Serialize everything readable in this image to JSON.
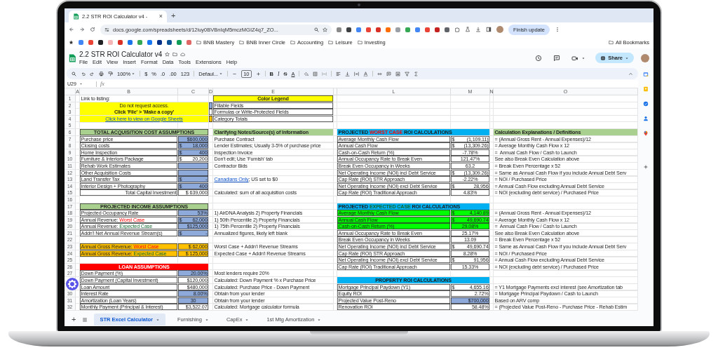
{
  "browser": {
    "tab_title": "2.2 STR ROI Calculator v4 -",
    "tab_close": "×",
    "new_tab": "+",
    "url": "docs.google.com/spreadsheets/d/12iuy0BVBnIqM5mczMGIZ4q7_ZO...",
    "update_button": "Finish update",
    "bookmark_folders": [
      "BNB Mastery",
      "BNB Inner Circle",
      "Accounting",
      "Leisure",
      "Investing"
    ],
    "all_bookmarks": "All Bookmarks"
  },
  "doc": {
    "title": "2.2 STR ROI Calculator v4",
    "menu": [
      "File",
      "Edit",
      "View",
      "Insert",
      "Format",
      "Data",
      "Tools",
      "Extensions",
      "Help"
    ],
    "share": "Share"
  },
  "toolbar": {
    "zoom": "100%",
    "currency": "$",
    "percent": "%",
    "decimal_less": ".0",
    "decimal_more": ".00",
    "number_format": "123",
    "font": "Defaul...",
    "font_size": "10",
    "bold": "B",
    "italic": "I",
    "strikethrough": "S",
    "text_color": "A"
  },
  "formula_bar": {
    "name_box": "U29",
    "label": "fx"
  },
  "columns": [
    "A",
    "B",
    "C",
    "D",
    "E",
    "L",
    "M",
    "N",
    "O"
  ],
  "rows": [
    {
      "number": "1",
      "B": {
        "text": "Link to listing:"
      },
      "E": {
        "text": "Color Legend",
        "kind": "heading",
        "color": "#ffff00",
        "centered": true,
        "boxed": true
      }
    },
    {
      "number": "2",
      "B": {
        "text": "Do not request access.",
        "notice": true,
        "merged": true,
        "centered": true
      },
      "D": {
        "fillable": true,
        "boxed": true
      },
      "E": {
        "text": "Fillable Fields",
        "boxed": true
      }
    },
    {
      "number": "3",
      "B": {
        "text": "Click 'File' > 'Make a copy'",
        "notice": true,
        "merged": true,
        "centered": true,
        "kind": "strong"
      },
      "D": {
        "boxed": true
      },
      "E": {
        "text": "Formulas or Write-Protected Fields",
        "boxed": true
      }
    },
    {
      "number": "4",
      "B": {
        "text": "Click here to view on Google Sheets",
        "notice": true,
        "merged": true,
        "centered": true,
        "kind": "link"
      },
      "D": {
        "total": true,
        "boxed": true
      },
      "E": {
        "text": "Category Totals",
        "boxed": true
      }
    },
    {
      "number": "5"
    },
    {
      "number": "6",
      "B": {
        "text": "TOTAL ACQUISITION COST ASSUMPTIONS",
        "kind": "heading",
        "color": "#a9d08e",
        "centered": true,
        "merged": true,
        "boxed": true
      },
      "E": {
        "text": "Clarifying Notes/Source(s) of Information",
        "kind": "heading",
        "color": "#a9d08e",
        "centered": false
      },
      "L": {
        "parts": [
          {
            "text": "PROJECTED "
          },
          {
            "text": "WORST CASE",
            "kind": "warning"
          },
          {
            "text": " ROI CALCULATIONS"
          }
        ],
        "kind": "heading",
        "color": "#00b0f0",
        "merged": true,
        "centered": false
      },
      "O": {
        "text": "Calculation Explanations / Definitions",
        "kind": "heading",
        "color": "#a9d08e",
        "centered": false
      }
    },
    {
      "number": "7",
      "B": {
        "text": "Purchase price",
        "boxed": true
      },
      "C": {
        "text": "$600,000",
        "fillable": true,
        "boxed": true
      },
      "E": {
        "text": "Purchase Contract"
      },
      "L": {
        "text": "Average Monthly Cash Flow",
        "boxed": true
      },
      "M": {
        "prefix": "$",
        "text": "(1,109.11)",
        "boxed": true
      },
      "O": {
        "text": "= (Annual Gross Rent - Annual Expenses)/12"
      }
    },
    {
      "number": "8",
      "B": {
        "text": "Closing costs",
        "boxed": true
      },
      "C": {
        "prefix": "$",
        "text": "18,000",
        "fillable": true,
        "boxed": true
      },
      "E": {
        "text": "Lender Estimates; Usually 3-5% of purchase price"
      },
      "L": {
        "text": "Annual Cash Flow",
        "boxed": true
      },
      "M": {
        "prefix": "$",
        "text": "(13,309.26)",
        "boxed": true
      },
      "O": {
        "text": "= Average Monthly Cash Flow x 12"
      }
    },
    {
      "number": "9",
      "B": {
        "text": "Home Inspection",
        "boxed": true
      },
      "C": {
        "prefix": "$",
        "text": "400",
        "fillable": true,
        "boxed": true
      },
      "E": {
        "text": "Inspection Invoice"
      },
      "L": {
        "text": "Cash-on-Cash Return (%)",
        "boxed": true
      },
      "M": {
        "text": "-7.78%",
        "boxed": true,
        "centered": true
      },
      "O": {
        "text": "=  Annual Cash Flow / Cash to Launch"
      }
    },
    {
      "number": "10",
      "B": {
        "text": "Furniture & Interiors Package",
        "boxed": true
      },
      "C": {
        "prefix": "$",
        "text": "20,200",
        "boxed": true
      },
      "E": {
        "text": "Don't edit; Use 'Furnish' tab"
      },
      "L": {
        "text": "Annual Occupancy Rate to Break Even",
        "boxed": true
      },
      "M": {
        "text": "121.47%",
        "boxed": true,
        "centered": true
      },
      "O": {
        "text": "See also Break Even Calculation above"
      }
    },
    {
      "number": "11",
      "B": {
        "text": "Rehab Work Estimates",
        "boxed": true
      },
      "C": {
        "fillable": true,
        "boxed": true
      },
      "E": {
        "text": "Contractor Bids"
      },
      "L": {
        "text": "Break Even Occupancy in Weeks",
        "boxed": true
      },
      "M": {
        "text": "63.2",
        "boxed": true,
        "centered": true
      },
      "O": {
        "text": "= Break Even Percentage x 52"
      }
    },
    {
      "number": "12",
      "B": {
        "text": "Other Acquisition Costs",
        "boxed": true
      },
      "C": {
        "fillable": true,
        "boxed": true
      },
      "L": {
        "text": "Net Operating Income (NOI) incl Debt Service",
        "boxed": true
      },
      "M": {
        "prefix": "$",
        "text": "(13,309.26)",
        "boxed": true
      },
      "O": {
        "text": "= Same as Annual Cash Flow if you include Annual Debt Serv"
      }
    },
    {
      "number": "13",
      "B": {
        "text": "Land Transfer Tax",
        "boxed": true
      },
      "C": {
        "prefix": "$",
        "text": "-",
        "fillable": true,
        "boxed": true
      },
      "E": {
        "parts": [
          {
            "text": "Canadians Only",
            "link": true
          },
          {
            "text": "; US set to $0"
          }
        ]
      },
      "L": {
        "text": "Cap Rate (ROI) STR Approach",
        "boxed": true
      },
      "M": {
        "text": "-2.22%",
        "boxed": true,
        "centered": true
      },
      "O": {
        "text": "= NOI / Purchased Price"
      }
    },
    {
      "number": "14",
      "B": {
        "text": "Interior Design + Photography",
        "boxed": true
      },
      "C": {
        "prefix": "$",
        "text": "400",
        "fillable": true,
        "boxed": true
      },
      "L": {
        "text": "Net Operating Income (NOI) excl Debt Service",
        "boxed": true
      },
      "M": {
        "prefix": "$",
        "text": "28,956",
        "boxed": true
      },
      "O": {
        "text": "= Annual Cash Flow excluding Annual Debt Service"
      }
    },
    {
      "number": "15",
      "B": {
        "text": "Total Capital Investment",
        "boxed": true,
        "right_aligned": true
      },
      "C": {
        "text": "$ 639,000",
        "boxed": true
      },
      "E": {
        "text": "Calculated: sum of all acquisition costs"
      },
      "L": {
        "text": "Cap Rate (ROI) Traditional Approach",
        "boxed": true
      },
      "M": {
        "text": "4.83%",
        "boxed": true,
        "centered": true
      },
      "O": {
        "text": "= NOI (excluding debt service) / Purchased Price"
      }
    },
    {
      "number": "16"
    },
    {
      "number": "17",
      "B": {
        "text": "PROJECTED INCOME ASSUMPTIONS",
        "kind": "heading",
        "color": "#a9d08e",
        "centered": true,
        "merged": true,
        "boxed": true
      },
      "L": {
        "parts": [
          {
            "text": "PROJECTED "
          },
          {
            "text": "EXPECTED CASE",
            "kind": "success"
          },
          {
            "text": " ROI CALCULATIONS"
          }
        ],
        "kind": "heading",
        "color": "#00b0f0",
        "merged": true,
        "centered": false
      }
    },
    {
      "number": "18",
      "B": {
        "text": "Projected Occupancy Rate",
        "boxed": true
      },
      "C": {
        "text": "53%",
        "fillable": true,
        "boxed": true
      },
      "E": {
        "text": "1) AirDNA Analysis 2) Property Financials"
      },
      "L": {
        "text": "Average Monthly Cash Flow",
        "highlight": true,
        "boxed": true
      },
      "M": {
        "prefix": "$",
        "text": "4,140.89",
        "highlight": true,
        "boxed": true
      },
      "O": {
        "text": "= (Annual Gross Rent - Annual Expenses)/12"
      }
    },
    {
      "number": "19",
      "B": {
        "parts": [
          {
            "text": "Annual Revenue: "
          },
          {
            "text": "Worst Case",
            "kind": "warning"
          }
        ],
        "boxed": true
      },
      "C": {
        "prefix": "$",
        "text": "62,000",
        "fillable": true,
        "boxed": true
      },
      "E": {
        "text": "1) 50th Percentile 2) Property Financials"
      },
      "L": {
        "text": "Annual Cash Flow",
        "highlight": true,
        "boxed": true
      },
      "M": {
        "prefix": "$",
        "text": "49,690.74",
        "highlight": true,
        "boxed": true
      },
      "O": {
        "text": "= Average Monthly Cash Flow x 12"
      }
    },
    {
      "number": "20",
      "B": {
        "parts": [
          {
            "text": "Annual Revenue: "
          },
          {
            "text": "Expected Case",
            "kind": "success"
          }
        ],
        "boxed": true
      },
      "C": {
        "text": "$125,000",
        "fillable": true,
        "boxed": true
      },
      "E": {
        "text": "1) 75th Percentile 2) Property Financials"
      },
      "L": {
        "text": "Cash-on-Cash Return (%)",
        "highlight": true,
        "boxed": true
      },
      "M": {
        "text": "29.08%",
        "highlight": true,
        "boxed": true,
        "centered": true
      },
      "O": {
        "text": "=  Annual Cash Flow / Cash to Launch"
      }
    },
    {
      "number": "21",
      "B": {
        "text": "Addn'l Net Annual Revenue Stream(s)",
        "boxed": true
      },
      "C": {
        "prefix": "$",
        "text": "-",
        "fillable": true,
        "boxed": true
      },
      "E": {
        "text": "Annualized figures, likely left blank"
      },
      "L": {
        "text": "Annual Occupancy Rate to Break Even",
        "boxed": true
      },
      "M": {
        "text": "25.17%",
        "boxed": true,
        "centered": true
      },
      "O": {
        "text": "See also Break Even Calculation above"
      }
    },
    {
      "number": "22",
      "L": {
        "text": "Break Even Occupancy in Weeks",
        "boxed": true
      },
      "M": {
        "text": "13.09",
        "boxed": true,
        "centered": true
      },
      "O": {
        "text": "= Break Even Percentage x 52"
      }
    },
    {
      "number": "23",
      "B": {
        "parts": [
          {
            "text": "Annual Gross Revenue: "
          },
          {
            "text": "Worst Case",
            "kind": "warning"
          }
        ],
        "total": true,
        "boxed": true
      },
      "C": {
        "text": "$ 62,000",
        "total": true,
        "boxed": true
      },
      "E": {
        "text": "Worst Case + Addn'l Revenue Streams"
      },
      "L": {
        "text": "Net Operating Income (NOI) incl Debt Service",
        "boxed": true
      },
      "M": {
        "prefix": "$",
        "text": "49,690.74",
        "boxed": true
      },
      "O": {
        "text": "= Same as Annual Cash Flow if you include Annual Debt Serv"
      }
    },
    {
      "number": "24",
      "B": {
        "parts": [
          {
            "text": "Annual Gross Revenue: "
          },
          {
            "text": "Expected Case",
            "kind": "success"
          }
        ],
        "total": true,
        "boxed": true
      },
      "C": {
        "text": "$ 125,000",
        "total": true,
        "boxed": true
      },
      "E": {
        "text": "Expected Case + Addn'l Revenue Streams"
      },
      "L": {
        "text": "Cap Rate (ROI) STR Approach",
        "boxed": true
      },
      "M": {
        "text": "8.28%",
        "boxed": true,
        "centered": true
      },
      "O": {
        "text": "= NOI / Purchased Price"
      }
    },
    {
      "number": "25",
      "L": {
        "text": "Net Operating Income (NOI) excl Debt Service",
        "boxed": true
      },
      "M": {
        "prefix": "$",
        "text": "91,956",
        "boxed": true
      },
      "O": {
        "text": "= Annual Cash Flow excluding Annual Debt Service"
      }
    },
    {
      "number": "26",
      "B": {
        "text": "LOAN ASSUMPTIONS",
        "kind": "heading",
        "color": "#ff0000",
        "light_text": true,
        "centered": true,
        "merged": true
      },
      "L": {
        "text": "Cap Rate (ROI) Traditional Approach",
        "boxed": true
      },
      "M": {
        "text": "15.33%",
        "boxed": true,
        "centered": true
      },
      "O": {
        "text": "= NOI (excluding debt service) / Purchased Price"
      }
    },
    {
      "number": "27",
      "B": {
        "text": "Down Payment (%)",
        "boxed": true
      },
      "C": {
        "text": "20.00%",
        "fillable": true,
        "boxed": true
      },
      "E": {
        "text": "Most lenders require 20%"
      }
    },
    {
      "B": {
        "text": "Down Payment (Capital Investment)",
        "boxed": true
      },
      "C": {
        "text": "$120,000",
        "boxed": true
      },
      "E": {
        "text": "Calculated: Down Payment % x Purchase Price"
      },
      "L": {
        "text": "PROPERTY ROI CALCULATIONS",
        "kind": "heading",
        "color": "#00b0f0",
        "centered": true,
        "merged": true
      }
    },
    {
      "B": {
        "text": "Loan Amount",
        "boxed": true
      },
      "C": {
        "text": "$480,000",
        "boxed": true
      },
      "E": {
        "text": "Calculated: Purchase Price - Down Payment"
      },
      "L": {
        "text": "Mortgage Principal Paydown (Y1)",
        "boxed": true
      },
      "M": {
        "prefix": "$",
        "text": "4,655.16",
        "boxed": true
      },
      "O": {
        "text": "= Y1 Mortgage Payments excl interest (see Amortization tab"
      }
    },
    {
      "number": "30",
      "B": {
        "text": "Interest Rate",
        "boxed": true
      },
      "C": {
        "text": "8.00%",
        "fillable": true,
        "boxed": true
      },
      "E": {
        "text": "Obtain from your lender"
      },
      "L": {
        "text": "Equity ROI",
        "boxed": true
      },
      "M": {
        "text": "2.72%",
        "boxed": true
      },
      "O": {
        "text": "= Mortgage Principal Paydown / Cash to Launch"
      }
    },
    {
      "number": "31",
      "B": {
        "text": "Amortization (Loan Years)",
        "boxed": true
      },
      "C": {
        "text": "30",
        "fillable": true,
        "boxed": true,
        "centered": true
      },
      "E": {
        "text": "Obtain from your lender"
      },
      "L": {
        "text": "Projected Value Post-Reno",
        "boxed": true
      },
      "M": {
        "text": "$700,000",
        "fillable": true,
        "boxed": true
      },
      "O": {
        "text": "Based on ARV comp"
      }
    },
    {
      "number": "32",
      "B": {
        "text": "Monthly Payment (Principal & Interest)",
        "boxed": true
      },
      "C": {
        "text": "$3,522.07",
        "boxed": true
      },
      "E": {
        "text": "Calculated: Mortgage calculator formula"
      },
      "L": {
        "text": "Renovation ROI",
        "boxed": true
      },
      "M": {
        "text": "58.48%",
        "boxed": true
      },
      "O": {
        "text": "= (Projected Value Post-Reno - Purchase Price - Rehab Estim"
      }
    }
  ],
  "sheet_tabs": {
    "add": "+",
    "tabs": [
      {
        "label": "STR Excel Calculator",
        "selected": true
      },
      {
        "label": "Furnishing",
        "selected": false
      },
      {
        "label": "CapEx",
        "selected": false
      },
      {
        "label": "1st Mtg Amortization",
        "selected": false
      }
    ]
  }
}
